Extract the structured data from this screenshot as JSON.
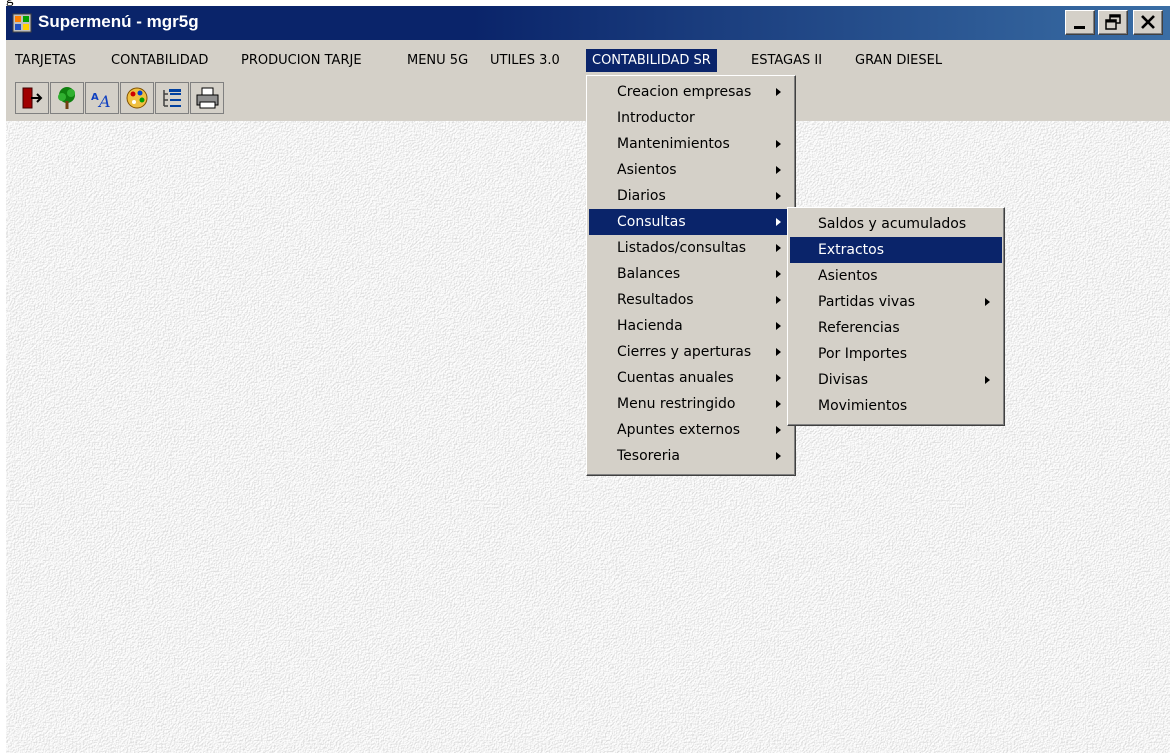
{
  "window": {
    "title": "Supermenú - mgr5g"
  },
  "menubar": [
    {
      "label": "TARJETAS",
      "active": false
    },
    {
      "label": "CONTABILIDAD",
      "active": false
    },
    {
      "label": "PRODUCION TARJE",
      "active": false
    },
    {
      "label": "MENU 5G",
      "active": false
    },
    {
      "label": "UTILES 3.0",
      "active": false
    },
    {
      "label": "CONTABILIDAD SR",
      "active": true
    },
    {
      "label": "ESTAGAS II",
      "active": false
    },
    {
      "label": "GRAN DIESEL",
      "active": false
    }
  ],
  "toolbar": {
    "icons": [
      "exit-icon",
      "tree-icon",
      "font-icon",
      "palette-icon",
      "list-icon",
      "printer-icon"
    ]
  },
  "menu_contabilidad_sr": {
    "items": [
      {
        "label": "Creacion empresas",
        "submenu": true
      },
      {
        "label": "Introductor",
        "submenu": false
      },
      {
        "label": "Mantenimientos",
        "submenu": true
      },
      {
        "label": "Asientos",
        "submenu": true
      },
      {
        "label": "Diarios",
        "submenu": true
      },
      {
        "label": "Consultas",
        "submenu": true,
        "highlighted": true
      },
      {
        "label": "Listados/consultas",
        "submenu": true
      },
      {
        "label": "Balances",
        "submenu": true
      },
      {
        "label": "Resultados",
        "submenu": true
      },
      {
        "label": "Hacienda",
        "submenu": true
      },
      {
        "label": "Cierres y aperturas",
        "submenu": true
      },
      {
        "label": "Cuentas anuales",
        "submenu": true
      },
      {
        "label": "Menu restringido",
        "submenu": true
      },
      {
        "label": "Apuntes externos",
        "submenu": true
      },
      {
        "label": "Tesoreria",
        "submenu": true
      }
    ]
  },
  "submenu_consultas": {
    "items": [
      {
        "label": "Saldos y acumulados",
        "submenu": false
      },
      {
        "label": "Extractos",
        "submenu": false,
        "highlighted": true
      },
      {
        "label": "Asientos",
        "submenu": false
      },
      {
        "label": "Partidas vivas",
        "submenu": true
      },
      {
        "label": "Referencias",
        "submenu": false
      },
      {
        "label": "Por Importes",
        "submenu": false
      },
      {
        "label": "Divisas",
        "submenu": true
      },
      {
        "label": "Movimientos",
        "submenu": false
      }
    ]
  },
  "colors": {
    "highlight": "#0a246a",
    "face": "#d4d0c8",
    "titlebar_start": "#0a246a",
    "titlebar_end": "#3a6ea5"
  }
}
